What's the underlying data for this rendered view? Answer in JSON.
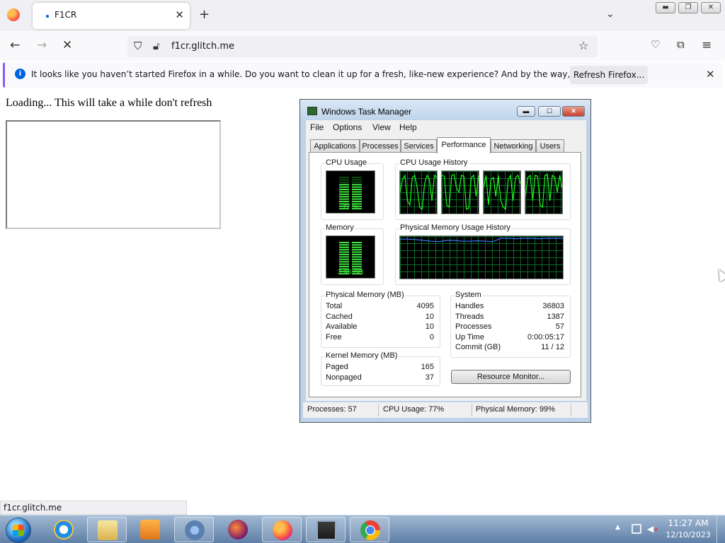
{
  "browser": {
    "tab_title": "F1CR",
    "url": "f1cr.glitch.me",
    "status_url": "f1cr.glitch.me",
    "notification": {
      "message": "It looks like you haven’t started Firefox in a while. Do you want to clean it up for a fresh, like-new experience? And by the way, welcome back!",
      "button": "Refresh Firefox..."
    }
  },
  "page": {
    "loading_text": "Loading... This will take a while don't refresh"
  },
  "task_manager": {
    "title": "Windows Task Manager",
    "menu": [
      "File",
      "Options",
      "View",
      "Help"
    ],
    "tabs": [
      "Applications",
      "Processes",
      "Services",
      "Performance",
      "Networking",
      "Users"
    ],
    "active_tab": "Performance",
    "cpu_usage": {
      "label": "CPU Usage",
      "value": "77 %",
      "level": 0.77
    },
    "cpu_history_label": "CPU Usage History",
    "memory": {
      "label": "Memory",
      "value": "3.98 GB",
      "level": 0.99
    },
    "memory_history_label": "Physical Memory Usage History",
    "physical_memory": {
      "title": "Physical Memory (MB)",
      "rows": [
        {
          "k": "Total",
          "v": "4095"
        },
        {
          "k": "Cached",
          "v": "10"
        },
        {
          "k": "Available",
          "v": "10"
        },
        {
          "k": "Free",
          "v": "0"
        }
      ]
    },
    "kernel_memory": {
      "title": "Kernel Memory (MB)",
      "rows": [
        {
          "k": "Paged",
          "v": "165"
        },
        {
          "k": "Nonpaged",
          "v": "37"
        }
      ]
    },
    "system": {
      "title": "System",
      "rows": [
        {
          "k": "Handles",
          "v": "36803"
        },
        {
          "k": "Threads",
          "v": "1387"
        },
        {
          "k": "Processes",
          "v": "57"
        },
        {
          "k": "Up Time",
          "v": "0:00:05:17"
        },
        {
          "k": "Commit (GB)",
          "v": "11 / 12"
        }
      ]
    },
    "resource_monitor_button": "Resource Monitor...",
    "status": {
      "processes": "Processes: 57",
      "cpu": "CPU Usage: 77%",
      "memory": "Physical Memory: 99%"
    }
  },
  "taskbar": {
    "clock_time": "11:27 AM",
    "clock_date": "12/10/2023",
    "pinned": [
      "internet-explorer-icon",
      "file-explorer-icon",
      "media-player-icon",
      "chromium-icon",
      "firefox-nightly-icon",
      "firefox-icon",
      "task-manager-icon",
      "chrome-icon"
    ]
  },
  "colors": {
    "meter_green": "#3fe03f",
    "graph_green": "#19ff19",
    "memory_line": "#3b7bff",
    "firefox_accent": "#9059ff"
  }
}
